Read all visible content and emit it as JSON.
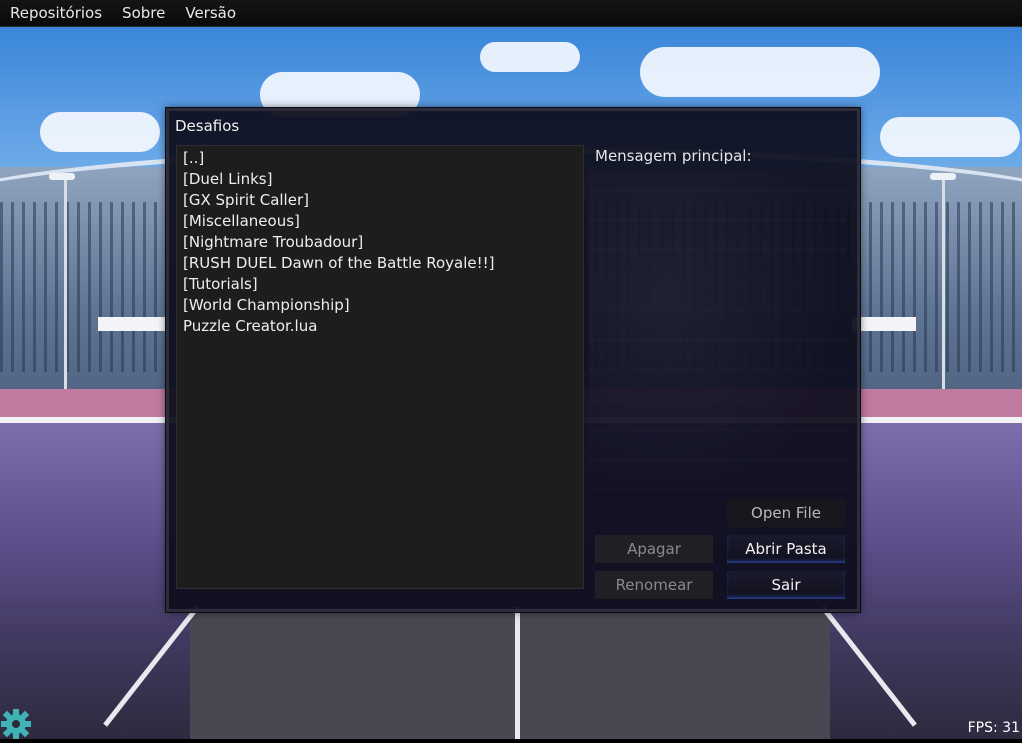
{
  "menu": {
    "items": [
      "Repositórios",
      "Sobre",
      "Versão"
    ]
  },
  "dialog": {
    "title": "Desafios",
    "files": [
      "[..]",
      "[Duel Links]",
      "[GX Spirit Caller]",
      "[Miscellaneous]",
      "[Nightmare Troubadour]",
      "[RUSH DUEL Dawn of the Battle Royale!!]",
      "[Tutorials]",
      "[World Championship]",
      "Puzzle Creator.lua"
    ],
    "message_label": "Mensagem principal:",
    "buttons": {
      "open_file": "Open File",
      "delete": "Apagar",
      "open_folder": "Abrir Pasta",
      "rename": "Renomear",
      "exit": "Sair"
    }
  },
  "status": {
    "fps": "FPS: 31"
  },
  "icons": {
    "settings": "gear-icon"
  },
  "colors": {
    "dialog_bg": "#0e0e1e",
    "list_bg": "#1d1d1d",
    "button_glow": "#3c6eff",
    "gear": "#3fb3b8"
  }
}
